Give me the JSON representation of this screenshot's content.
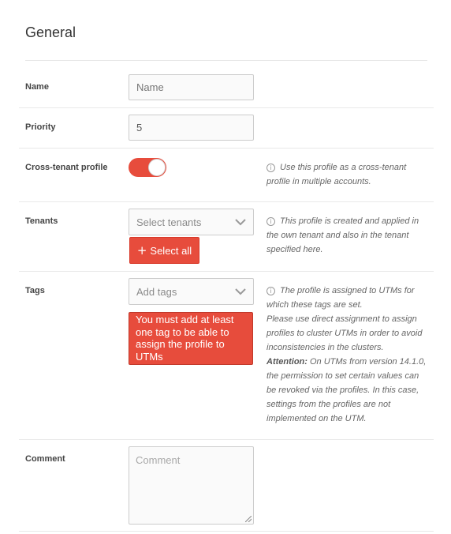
{
  "section": {
    "title": "General"
  },
  "name": {
    "label": "Name",
    "placeholder": "Name",
    "value": ""
  },
  "priority": {
    "label": "Priority",
    "value": "5"
  },
  "cross_tenant": {
    "label": "Cross-tenant profile",
    "enabled": true,
    "help": "Use this profile as a cross-tenant profile in multiple accounts."
  },
  "tenants": {
    "label": "Tenants",
    "placeholder": "Select tenants",
    "select_all_label": "Select all",
    "help": "This profile is created and applied in the own tenant and also in the tenant specified here."
  },
  "tags": {
    "label": "Tags",
    "placeholder": "Add tags",
    "error": "You must add at least one tag to be able to assign the profile to UTMs",
    "help_1": "The profile is assigned to UTMs for which these tags are set.",
    "help_2": "Please use direct assignment to assign profiles to cluster UTMs in order to avoid inconsistencies in the clusters.",
    "help_attention_label": "Attention:",
    "help_3": "On UTMs from version 14.1.0, the permission to set certain values can be revoked via the profiles. In this case, settings from the profiles are not implemented on the UTM."
  },
  "comment": {
    "label": "Comment",
    "placeholder": "Comment"
  },
  "colors": {
    "accent": "#e74c3c",
    "border": "#cccccc",
    "input_bg": "#fafafa"
  },
  "icons": {
    "info": "info-circle-icon",
    "dropdown": "chevron-down-icon",
    "add": "plus-icon"
  }
}
